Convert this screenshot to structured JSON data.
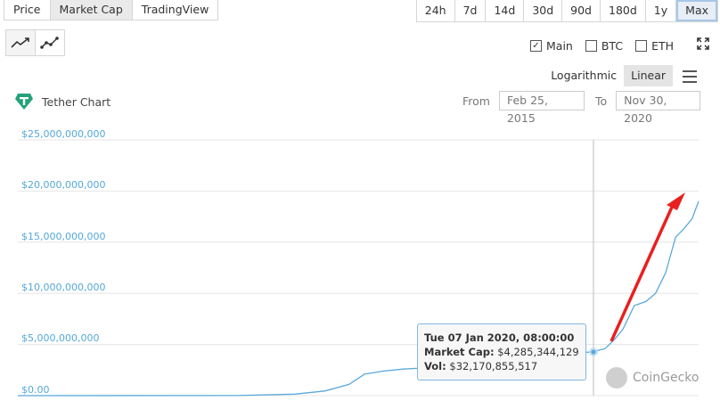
{
  "tabs": [
    {
      "label": "Price"
    },
    {
      "label": "Market Cap"
    },
    {
      "label": "TradingView"
    }
  ],
  "ranges": [
    {
      "label": "24h"
    },
    {
      "label": "7d"
    },
    {
      "label": "14d"
    },
    {
      "label": "30d"
    },
    {
      "label": "90d"
    },
    {
      "label": "180d"
    },
    {
      "label": "1y"
    },
    {
      "label": "Max"
    }
  ],
  "checkboxes": [
    {
      "label": "Main",
      "checked": true
    },
    {
      "label": "BTC",
      "checked": false
    },
    {
      "label": "ETH",
      "checked": false
    }
  ],
  "scale": {
    "log_label": "Logarithmic",
    "linear_label": "Linear"
  },
  "chart_title": "Tether Chart",
  "date_range": {
    "from_label": "From",
    "from_value": "Feb 25, 2015",
    "to_label": "To",
    "to_value": "Nov 30, 2020"
  },
  "tooltip": {
    "date": "Tue 07 Jan 2020, 08:00:00",
    "market_cap_label": "Market Cap:",
    "market_cap_value": "$4,285,344,129",
    "vol_label": "Vol:",
    "vol_value": "$32,170,855,517"
  },
  "watermark": "CoinGecko",
  "colors": {
    "line": "#5aa9da",
    "accent": "#26a17b",
    "arrow": "#e8201f"
  },
  "chart_data": {
    "type": "line",
    "ylim": [
      0,
      25000000000
    ],
    "ytick_labels": [
      "$0.00",
      "$5,000,000,000",
      "$10,000,000,000",
      "$15,000,000,000",
      "$20,000,000,000",
      "$25,000,000,000"
    ],
    "yticks": [
      0,
      5000000000,
      10000000000,
      15000000000,
      20000000000,
      25000000000
    ],
    "x": [
      "2015-02-25",
      "2017-01-01",
      "2017-07-01",
      "2017-10-01",
      "2017-12-15",
      "2018-02-01",
      "2018-04-01",
      "2018-06-01",
      "2018-09-01",
      "2018-10-20",
      "2019-01-01",
      "2019-03-01",
      "2019-05-01",
      "2019-06-01",
      "2019-08-01",
      "2019-11-01",
      "2020-01-07",
      "2020-02-15",
      "2020-03-15",
      "2020-04-10",
      "2020-05-15",
      "2020-06-20",
      "2020-07-20",
      "2020-08-20",
      "2020-09-20",
      "2020-10-15",
      "2020-11-10",
      "2020-11-30"
    ],
    "values": [
      0,
      10000000,
      150000000,
      450000000,
      1100000000,
      2100000000,
      2400000000,
      2600000000,
      2750000000,
      1850000000,
      2000000000,
      2000000000,
      2600000000,
      3400000000,
      4000000000,
      4100000000,
      4285344129,
      4600000000,
      5500000000,
      6500000000,
      8800000000,
      9200000000,
      10000000000,
      12000000000,
      15500000000,
      16300000000,
      17300000000,
      19000000000
    ]
  }
}
